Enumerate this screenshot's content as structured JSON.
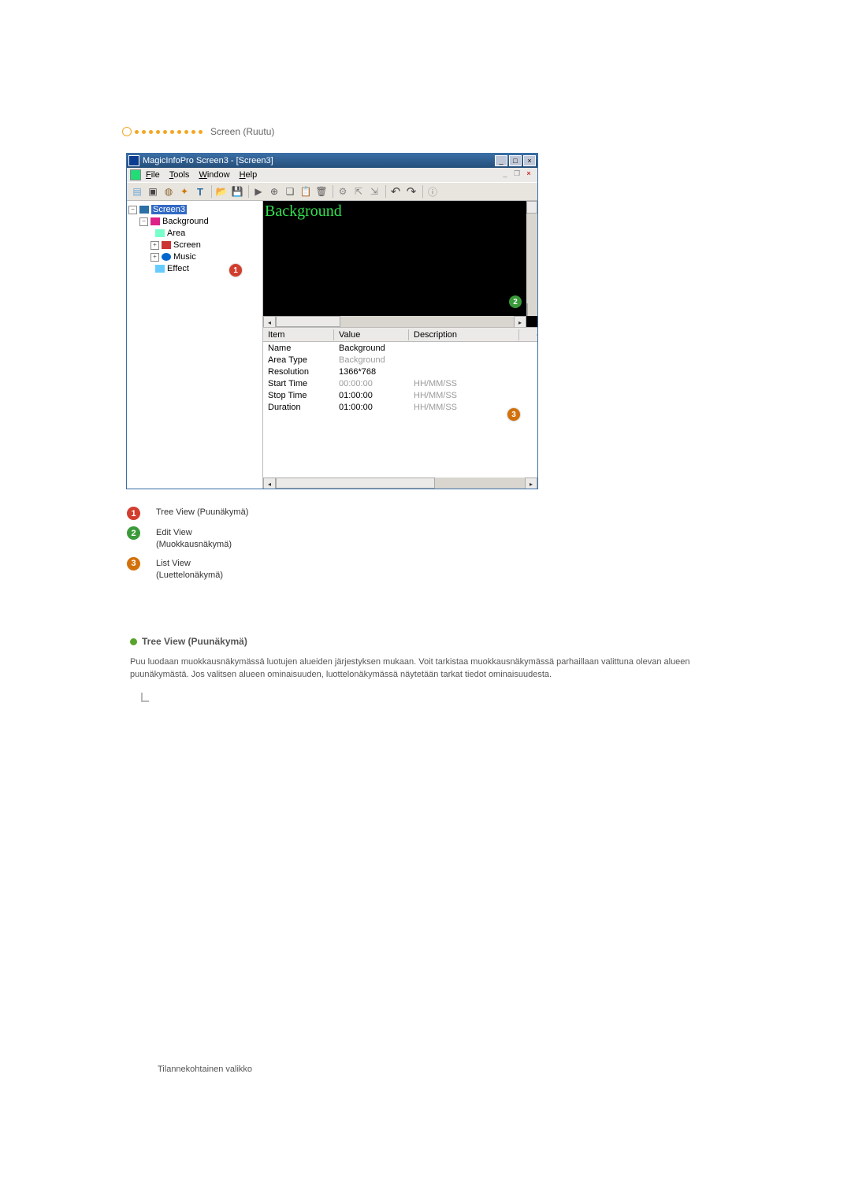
{
  "section": {
    "title": "Screen (Ruutu)"
  },
  "window": {
    "title": "MagicInfoPro Screen3 - [Screen3]",
    "menus": [
      "File",
      "Tools",
      "Window",
      "Help"
    ],
    "tree": {
      "root": "Screen3",
      "children": [
        {
          "label": "Background",
          "children": [
            {
              "label": "Area"
            },
            {
              "label": "Screen",
              "expandable": true
            },
            {
              "label": "Music",
              "expandable": true
            },
            {
              "label": "Effect"
            }
          ]
        }
      ]
    },
    "edit_label": "Background",
    "list": {
      "headers": [
        "Item",
        "Value",
        "Description"
      ],
      "rows": [
        {
          "item": "Name",
          "value": "Background",
          "desc": "",
          "value_dim": false
        },
        {
          "item": "Area Type",
          "value": "Background",
          "desc": "",
          "value_dim": true
        },
        {
          "item": "Resolution",
          "value": "1366*768",
          "desc": "",
          "value_dim": false
        },
        {
          "item": "Start Time",
          "value": "00:00:00",
          "desc": "HH/MM/SS",
          "value_dim": true,
          "desc_dim": true
        },
        {
          "item": "Stop Time",
          "value": "01:00:00",
          "desc": "HH/MM/SS",
          "value_dim": false,
          "desc_dim": true
        },
        {
          "item": "Duration",
          "value": "01:00:00",
          "desc": "HH/MM/SS",
          "value_dim": false,
          "desc_dim": true
        }
      ]
    }
  },
  "legend": [
    {
      "n": "1",
      "cls": "ln1",
      "text": "Tree View (Puunäkymä)"
    },
    {
      "n": "2",
      "cls": "ln2",
      "text": "Edit View\n(Muokkausnäkymä)"
    },
    {
      "n": "3",
      "cls": "ln3",
      "text": "List View\n(Luettelonäkymä)"
    }
  ],
  "subsection": {
    "title": "Tree View (Puunäkymä)",
    "body": "Puu luodaan muokkausnäkymässä luotujen alueiden järjestyksen mukaan. Voit tarkistaa muokkausnäkymässä parhaillaan valittuna olevan alueen puunäkymästä. Jos valitsen alueen ominaisuuden, luottelonäkymässä näytetään tarkat tiedot ominaisuudesta."
  },
  "footer": "Tilannekohtainen valikko"
}
